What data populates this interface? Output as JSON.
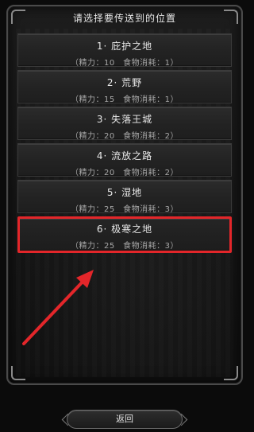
{
  "dialog": {
    "title": "请选择要传送到的位置"
  },
  "options": [
    {
      "name": "1· 庇护之地",
      "cost": "（精力：10　食物消耗：1）"
    },
    {
      "name": "2· 荒野",
      "cost": "（精力：15　食物消耗：1）"
    },
    {
      "name": "3· 失落王城",
      "cost": "（精力：20　食物消耗：2）"
    },
    {
      "name": "4· 流放之路",
      "cost": "（精力：20　食物消耗：2）"
    },
    {
      "name": "5· 湿地",
      "cost": "（精力：25　食物消耗：3）"
    },
    {
      "name": "6· 极寒之地",
      "cost": "（精力：25　食物消耗：3）"
    }
  ],
  "selected_index": 6,
  "footer": {
    "back_label": "返回"
  },
  "colors": {
    "highlight": "#e3262a",
    "panel_bg": "#151515"
  }
}
